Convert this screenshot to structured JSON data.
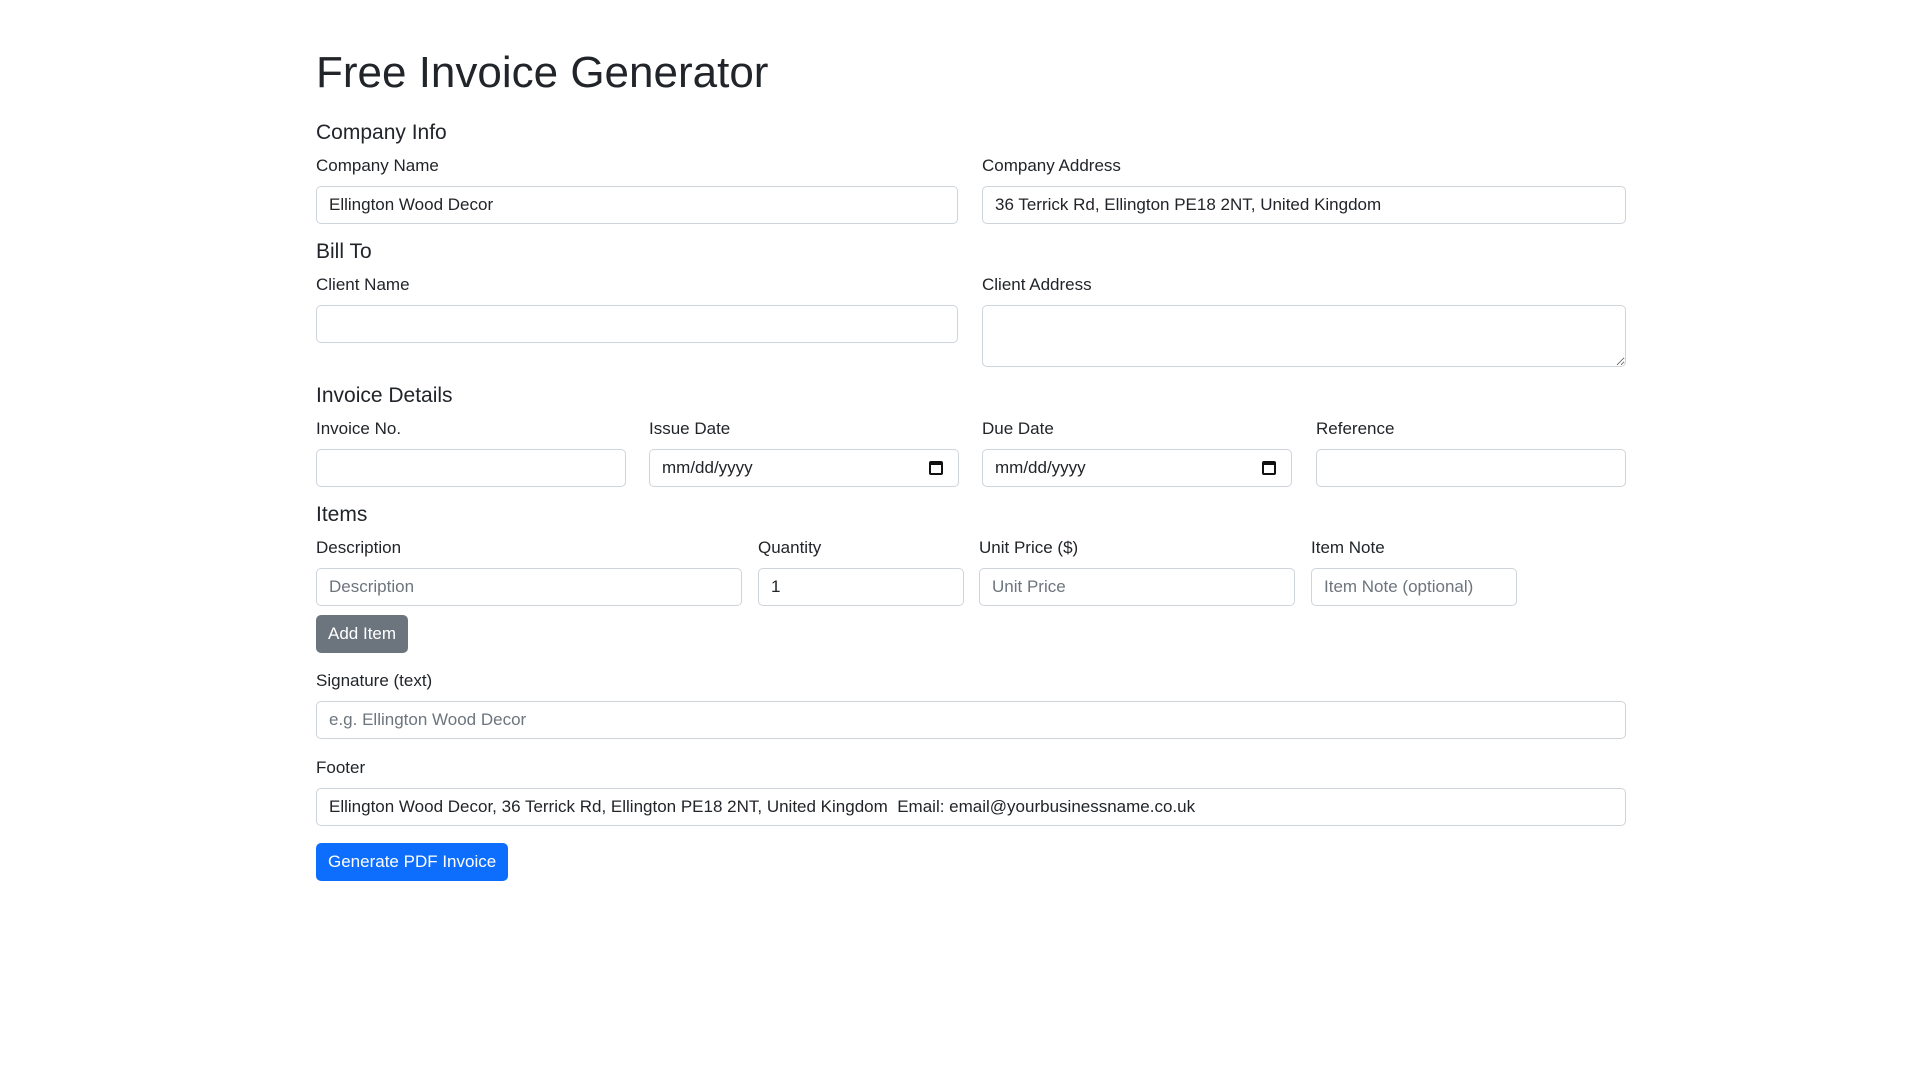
{
  "page": {
    "title": "Free Invoice Generator"
  },
  "company_info": {
    "heading": "Company Info",
    "name_label": "Company Name",
    "name_value": "Ellington Wood Decor",
    "address_label": "Company Address",
    "address_value": "36 Terrick Rd, Ellington PE18 2NT, United Kingdom"
  },
  "bill_to": {
    "heading": "Bill To",
    "client_name_label": "Client Name",
    "client_name_value": "",
    "client_address_label": "Client Address",
    "client_address_value": ""
  },
  "invoice_details": {
    "heading": "Invoice Details",
    "invoice_no_label": "Invoice No.",
    "invoice_no_value": "",
    "issue_date_label": "Issue Date",
    "issue_date_value": "mm/dd/yyyy",
    "due_date_label": "Due Date",
    "due_date_value": "mm/dd/yyyy",
    "reference_label": "Reference",
    "reference_value": ""
  },
  "items": {
    "heading": "Items",
    "description_label": "Description",
    "description_placeholder": "Description",
    "quantity_label": "Quantity",
    "quantity_value": "1",
    "unit_price_label": "Unit Price ($)",
    "unit_price_placeholder": "Unit Price",
    "item_note_label": "Item Note",
    "item_note_placeholder": "Item Note (optional)",
    "add_item_button": "Add Item"
  },
  "signature": {
    "label": "Signature (text)",
    "placeholder": "e.g. Ellington Wood Decor"
  },
  "footer": {
    "label": "Footer",
    "value": "Ellington Wood Decor, 36 Terrick Rd, Ellington PE18 2NT, United Kingdom  Email: email@yourbusinessname.co.uk"
  },
  "actions": {
    "generate_button": "Generate PDF Invoice"
  },
  "colors": {
    "primary": "#0d6efd",
    "secondary": "#6c757d",
    "border": "#ced4da",
    "text": "#212529"
  },
  "icons": {
    "date_picker": "calendar-icon"
  }
}
